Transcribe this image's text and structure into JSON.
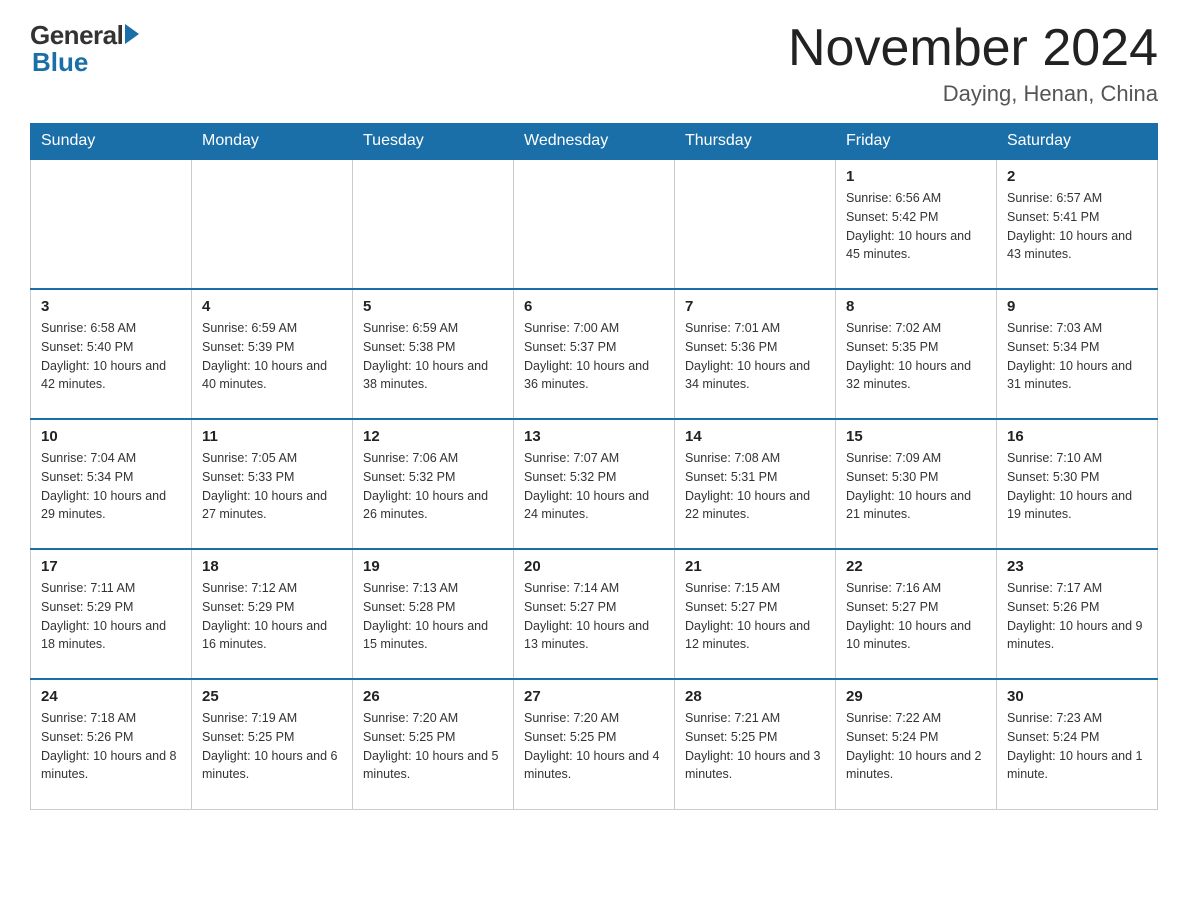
{
  "header": {
    "logo_general": "General",
    "logo_blue": "Blue",
    "month_title": "November 2024",
    "subtitle": "Daying, Henan, China"
  },
  "days_of_week": [
    "Sunday",
    "Monday",
    "Tuesday",
    "Wednesday",
    "Thursday",
    "Friday",
    "Saturday"
  ],
  "weeks": [
    [
      {
        "day": "",
        "info": ""
      },
      {
        "day": "",
        "info": ""
      },
      {
        "day": "",
        "info": ""
      },
      {
        "day": "",
        "info": ""
      },
      {
        "day": "",
        "info": ""
      },
      {
        "day": "1",
        "info": "Sunrise: 6:56 AM\nSunset: 5:42 PM\nDaylight: 10 hours and 45 minutes."
      },
      {
        "day": "2",
        "info": "Sunrise: 6:57 AM\nSunset: 5:41 PM\nDaylight: 10 hours and 43 minutes."
      }
    ],
    [
      {
        "day": "3",
        "info": "Sunrise: 6:58 AM\nSunset: 5:40 PM\nDaylight: 10 hours and 42 minutes."
      },
      {
        "day": "4",
        "info": "Sunrise: 6:59 AM\nSunset: 5:39 PM\nDaylight: 10 hours and 40 minutes."
      },
      {
        "day": "5",
        "info": "Sunrise: 6:59 AM\nSunset: 5:38 PM\nDaylight: 10 hours and 38 minutes."
      },
      {
        "day": "6",
        "info": "Sunrise: 7:00 AM\nSunset: 5:37 PM\nDaylight: 10 hours and 36 minutes."
      },
      {
        "day": "7",
        "info": "Sunrise: 7:01 AM\nSunset: 5:36 PM\nDaylight: 10 hours and 34 minutes."
      },
      {
        "day": "8",
        "info": "Sunrise: 7:02 AM\nSunset: 5:35 PM\nDaylight: 10 hours and 32 minutes."
      },
      {
        "day": "9",
        "info": "Sunrise: 7:03 AM\nSunset: 5:34 PM\nDaylight: 10 hours and 31 minutes."
      }
    ],
    [
      {
        "day": "10",
        "info": "Sunrise: 7:04 AM\nSunset: 5:34 PM\nDaylight: 10 hours and 29 minutes."
      },
      {
        "day": "11",
        "info": "Sunrise: 7:05 AM\nSunset: 5:33 PM\nDaylight: 10 hours and 27 minutes."
      },
      {
        "day": "12",
        "info": "Sunrise: 7:06 AM\nSunset: 5:32 PM\nDaylight: 10 hours and 26 minutes."
      },
      {
        "day": "13",
        "info": "Sunrise: 7:07 AM\nSunset: 5:32 PM\nDaylight: 10 hours and 24 minutes."
      },
      {
        "day": "14",
        "info": "Sunrise: 7:08 AM\nSunset: 5:31 PM\nDaylight: 10 hours and 22 minutes."
      },
      {
        "day": "15",
        "info": "Sunrise: 7:09 AM\nSunset: 5:30 PM\nDaylight: 10 hours and 21 minutes."
      },
      {
        "day": "16",
        "info": "Sunrise: 7:10 AM\nSunset: 5:30 PM\nDaylight: 10 hours and 19 minutes."
      }
    ],
    [
      {
        "day": "17",
        "info": "Sunrise: 7:11 AM\nSunset: 5:29 PM\nDaylight: 10 hours and 18 minutes."
      },
      {
        "day": "18",
        "info": "Sunrise: 7:12 AM\nSunset: 5:29 PM\nDaylight: 10 hours and 16 minutes."
      },
      {
        "day": "19",
        "info": "Sunrise: 7:13 AM\nSunset: 5:28 PM\nDaylight: 10 hours and 15 minutes."
      },
      {
        "day": "20",
        "info": "Sunrise: 7:14 AM\nSunset: 5:27 PM\nDaylight: 10 hours and 13 minutes."
      },
      {
        "day": "21",
        "info": "Sunrise: 7:15 AM\nSunset: 5:27 PM\nDaylight: 10 hours and 12 minutes."
      },
      {
        "day": "22",
        "info": "Sunrise: 7:16 AM\nSunset: 5:27 PM\nDaylight: 10 hours and 10 minutes."
      },
      {
        "day": "23",
        "info": "Sunrise: 7:17 AM\nSunset: 5:26 PM\nDaylight: 10 hours and 9 minutes."
      }
    ],
    [
      {
        "day": "24",
        "info": "Sunrise: 7:18 AM\nSunset: 5:26 PM\nDaylight: 10 hours and 8 minutes."
      },
      {
        "day": "25",
        "info": "Sunrise: 7:19 AM\nSunset: 5:25 PM\nDaylight: 10 hours and 6 minutes."
      },
      {
        "day": "26",
        "info": "Sunrise: 7:20 AM\nSunset: 5:25 PM\nDaylight: 10 hours and 5 minutes."
      },
      {
        "day": "27",
        "info": "Sunrise: 7:20 AM\nSunset: 5:25 PM\nDaylight: 10 hours and 4 minutes."
      },
      {
        "day": "28",
        "info": "Sunrise: 7:21 AM\nSunset: 5:25 PM\nDaylight: 10 hours and 3 minutes."
      },
      {
        "day": "29",
        "info": "Sunrise: 7:22 AM\nSunset: 5:24 PM\nDaylight: 10 hours and 2 minutes."
      },
      {
        "day": "30",
        "info": "Sunrise: 7:23 AM\nSunset: 5:24 PM\nDaylight: 10 hours and 1 minute."
      }
    ]
  ]
}
